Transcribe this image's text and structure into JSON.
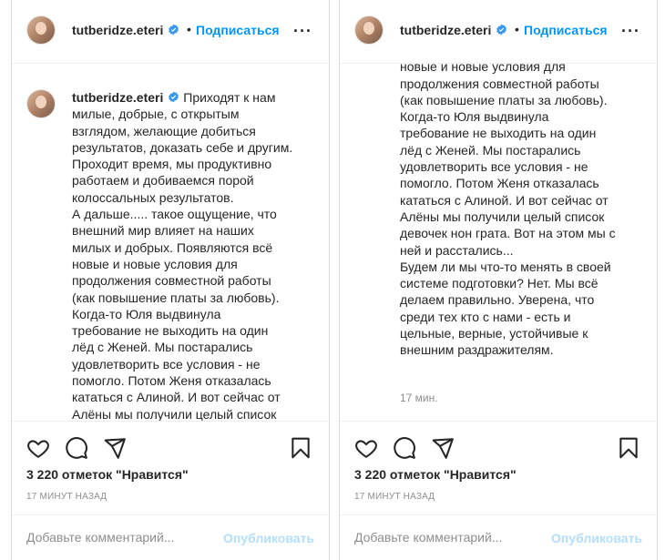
{
  "colors": {
    "accent": "#0095f6",
    "publish_disabled": "#b2dffc",
    "muted": "#8e8e8e",
    "text": "#262626"
  },
  "icons": {
    "like": "heart-icon",
    "comment": "speech-bubble-icon",
    "share": "paper-plane-icon",
    "save": "bookmark-icon",
    "verified": "verified-badge-icon",
    "more": "more-options-icon"
  },
  "panels": [
    {
      "header": {
        "username": "tutberidze.eteri",
        "dot": "•",
        "follow_label": "Подписаться",
        "more_label": "···"
      },
      "caption": {
        "username": "tutberidze.eteri",
        "text": "Приходят к нам\nмилые, добрые, с открытым\nвзглядом, желающие добиться\nрезультатов, доказать себе и другим.\nПроходит время, мы продуктивно\nработаем и добиваемся порой\nколоссальных результатов.\nА дальше..... такое ощущение, что\nвнешний мир влияет на наших\nмилых и добрых. Появляются всё\nновые и новые условия для\nпродолжения совместной работы\n(как повышение платы за любовь).\nКогда-то Юля выдвинула\nтребование не выходить на один\nлёд с Женей. Мы постарались\nудовлетворить все условия - не\nпомогло. Потом Женя отказалась\nкататься с Алиной. И вот сейчас от\nАлёны мы получили целый список"
      },
      "likes": "3 220 отметок \"Нравится\"",
      "time_ago": "17 МИНУТ НАЗАД",
      "comment_placeholder": "Добавьте комментарий...",
      "publish_label": "Опубликовать"
    },
    {
      "header": {
        "username": "tutberidze.eteri",
        "dot": "•",
        "follow_label": "Подписаться",
        "more_label": "···"
      },
      "caption": {
        "text": "результатов. доказать себе и другим.\nновые и новые условия для\nпродолжения совместной работы\n(как повышение платы за любовь).\nКогда-то Юля выдвинула\nтребование не выходить на один\nлёд с Женей. Мы постарались\nудовлетворить все условия - не\nпомогло. Потом Женя отказалась\nкататься с Алиной. И вот сейчас от\nАлёны мы получили целый список\nдевочек нон грата. Вот на этом мы с\nней и расстались...\nБудем ли мы что-то менять в своей\nсистеме подготовки? Нет. Мы всё\nделаем правильно. Уверена, что\nсреди тех кто с нами - есть и\nцельные, верные, устойчивые к\nвнешним раздражителям."
      },
      "comment_time": "17 мин.",
      "likes": "3 220 отметок \"Нравится\"",
      "time_ago": "17 МИНУТ НАЗАД",
      "comment_placeholder": "Добавьте комментарий...",
      "publish_label": "Опубликовать"
    }
  ]
}
